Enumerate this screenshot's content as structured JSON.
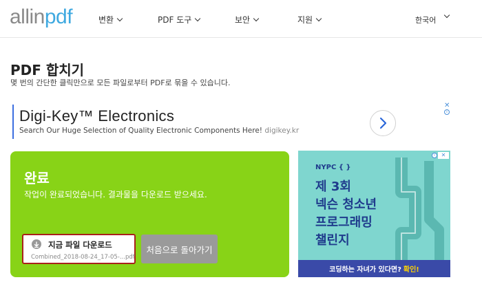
{
  "header": {
    "logo": {
      "part1": "allin",
      "part2": "pdf"
    },
    "nav": [
      {
        "label": "변환"
      },
      {
        "label": "PDF 도구"
      },
      {
        "label": "보안"
      },
      {
        "label": "지원"
      }
    ],
    "language": "한국어"
  },
  "page": {
    "title": "PDF 합치기",
    "subtitle": "몇 번의 간단한 클릭만으로 모든 파일로부터 PDF로 묶을 수 있습니다."
  },
  "ad_top": {
    "title": "Digi-Key™ Electronics",
    "text": "Search Our Huge Selection of Quality Electronic Components Here!",
    "domain": "digikey.kr"
  },
  "result": {
    "heading": "완료",
    "message": "작업이 완료되었습니다. 결과물을 다운로드 받으세요.",
    "download_label": "지금 파일 다운로드",
    "file_name": "Combined_2018-08-24_17-05-...pdf",
    "back_label": "처음으로 돌아가기"
  },
  "ad_right": {
    "brand": "NYPC { }",
    "headline": [
      "제 3회",
      "넥슨 청소년",
      "프로그래밍",
      "챌린지"
    ],
    "cta_text": "코딩하는 자녀가 있다면?",
    "cta_highlight": "확인!"
  },
  "colors": {
    "panel_green": "#88d317",
    "download_border": "#a8201a",
    "back_button": "#9a9a9a",
    "logo_accent": "#3fa9e0",
    "ad_right_bg": "#7fd6cf",
    "ad_right_text": "#1f3b8c",
    "ad_right_bar": "#3a4aa8"
  },
  "icons": {
    "download": "download-icon",
    "ad_next": "chevron-right-icon",
    "ad_close": "close-icon",
    "ad_info": "info-icon"
  }
}
